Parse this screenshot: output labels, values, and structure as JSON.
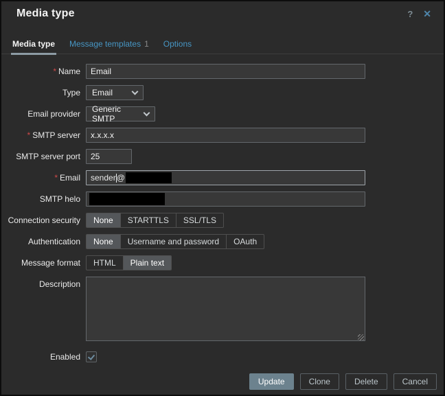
{
  "dialog": {
    "title": "Media type",
    "help": "?",
    "close": "✕"
  },
  "tabs": {
    "items": [
      {
        "label": "Media type",
        "active": true
      },
      {
        "label": "Message templates",
        "count": "1",
        "active": false
      },
      {
        "label": "Options",
        "active": false
      }
    ]
  },
  "form": {
    "required_mark": "*",
    "fields": {
      "name": {
        "label": "Name",
        "required": true,
        "value": "Email"
      },
      "type": {
        "label": "Type",
        "value": "Email"
      },
      "email_provider": {
        "label": "Email provider",
        "value": "Generic SMTP"
      },
      "smtp_server": {
        "label": "SMTP server",
        "required": true,
        "value": "x.x.x.x"
      },
      "smtp_port": {
        "label": "SMTP server port",
        "value": "25"
      },
      "email": {
        "label": "Email",
        "required": true,
        "value_before_caret": "sender",
        "value_after_caret": "@",
        "redacted": true,
        "focused": true
      },
      "smtp_helo": {
        "label": "SMTP helo",
        "value": "",
        "redacted": true
      },
      "connection_security": {
        "label": "Connection security",
        "options": [
          "None",
          "STARTTLS",
          "SSL/TLS"
        ],
        "selected": "None"
      },
      "authentication": {
        "label": "Authentication",
        "options": [
          "None",
          "Username and password",
          "OAuth"
        ],
        "selected": "None"
      },
      "message_format": {
        "label": "Message format",
        "options": [
          "HTML",
          "Plain text"
        ],
        "selected": "Plain text"
      },
      "description": {
        "label": "Description",
        "value": ""
      },
      "enabled": {
        "label": "Enabled",
        "checked": true
      }
    }
  },
  "footer": {
    "buttons": [
      {
        "label": "Update",
        "primary": true
      },
      {
        "label": "Clone",
        "primary": false
      },
      {
        "label": "Delete",
        "primary": false
      },
      {
        "label": "Cancel",
        "primary": false
      }
    ]
  },
  "colors": {
    "dialog_bg": "#2b2b2b",
    "input_bg": "#383838",
    "tab_link": "#4796c4",
    "active_tab_underline": "#8d9ba4",
    "primary_button": "#6c828e",
    "required_asterisk": "#d04949",
    "check": "#6d8ca0",
    "redaction": "#000000"
  }
}
